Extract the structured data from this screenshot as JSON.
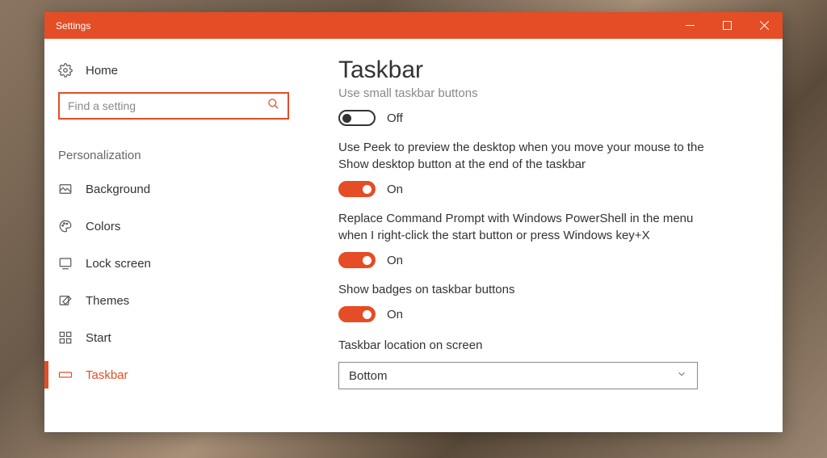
{
  "window": {
    "title": "Settings"
  },
  "sidebar": {
    "home": "Home",
    "search_placeholder": "Find a setting",
    "section": "Personalization",
    "items": [
      {
        "label": "Background"
      },
      {
        "label": "Colors"
      },
      {
        "label": "Lock screen"
      },
      {
        "label": "Themes"
      },
      {
        "label": "Start"
      },
      {
        "label": "Taskbar"
      }
    ]
  },
  "main": {
    "title": "Taskbar",
    "settings": {
      "small_buttons": {
        "label": "Use small taskbar buttons",
        "state": "Off"
      },
      "use_peek": {
        "label": "Use Peek to preview the desktop when you move your mouse to the Show desktop button at the end of the taskbar",
        "state": "On"
      },
      "powershell": {
        "label": "Replace Command Prompt with Windows PowerShell in the menu when I right-click the start button or press Windows key+X",
        "state": "On"
      },
      "badges": {
        "label": "Show badges on taskbar buttons",
        "state": "On"
      },
      "location": {
        "label": "Taskbar location on screen",
        "value": "Bottom"
      }
    }
  }
}
